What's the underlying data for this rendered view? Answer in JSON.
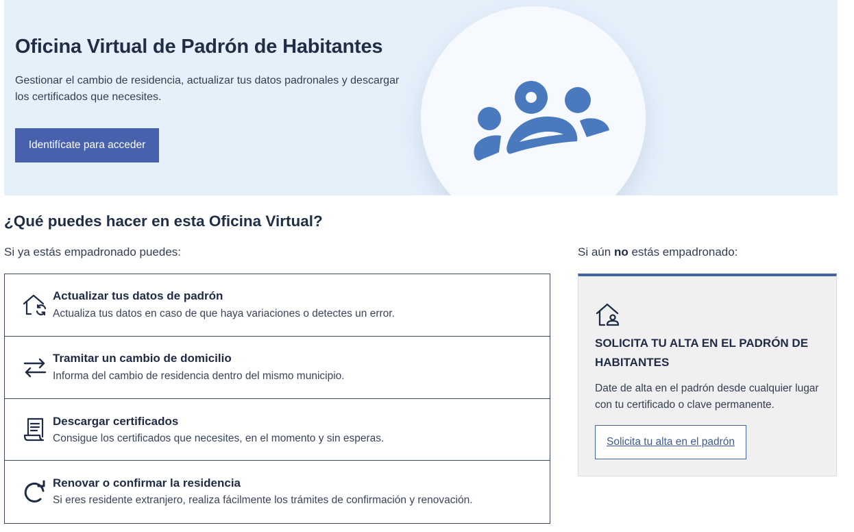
{
  "hero": {
    "title": "Oficina Virtual de Padrón de Habitantes",
    "description": "Gestionar el cambio de residencia, actualizar tus datos padronales y descargar los certificados que necesites.",
    "login_button": "Identifícate para acceder",
    "illustration_icon": "people-group-icon",
    "background_color": "#e6f0fb",
    "accent_color": "#4861ad"
  },
  "section": {
    "title": "¿Qué puedes hacer en esta Oficina Virtual?",
    "registered_intro": "Si ya estás empadronado puedes:",
    "unregistered_intro_prefix": "Si aún ",
    "unregistered_intro_bold": "no",
    "unregistered_intro_suffix": " estás empadronado:"
  },
  "options": [
    {
      "icon": "house-refresh-icon",
      "title": "Actualizar tus datos de padrón",
      "description": "Actualiza tus datos en caso de que haya variaciones o detectes un error."
    },
    {
      "icon": "swap-arrows-icon",
      "title": "Tramitar un cambio de domicilio",
      "description": "Informa del cambio de residencia dentro del mismo municipio."
    },
    {
      "icon": "certificate-scroll-icon",
      "title": "Descargar certificados",
      "description": "Consigue los certificados que necesites, en el momento y sin esperas."
    },
    {
      "icon": "renew-arrow-icon",
      "title": "Renovar o confirmar la residencia",
      "description": "Si eres residente extranjero, realiza fácilmente los trámites de confirmación y renovación."
    }
  ],
  "alta": {
    "icon": "house-person-icon",
    "title": "SOLICITA TU ALTA EN EL PADRÓN DE HABITANTES",
    "description": "Date de alta en el padrón desde cualquier lugar con tu certificado o clave permanente.",
    "link_label": "Solicita tu alta en el padrón",
    "border_color": "#4565a0"
  }
}
